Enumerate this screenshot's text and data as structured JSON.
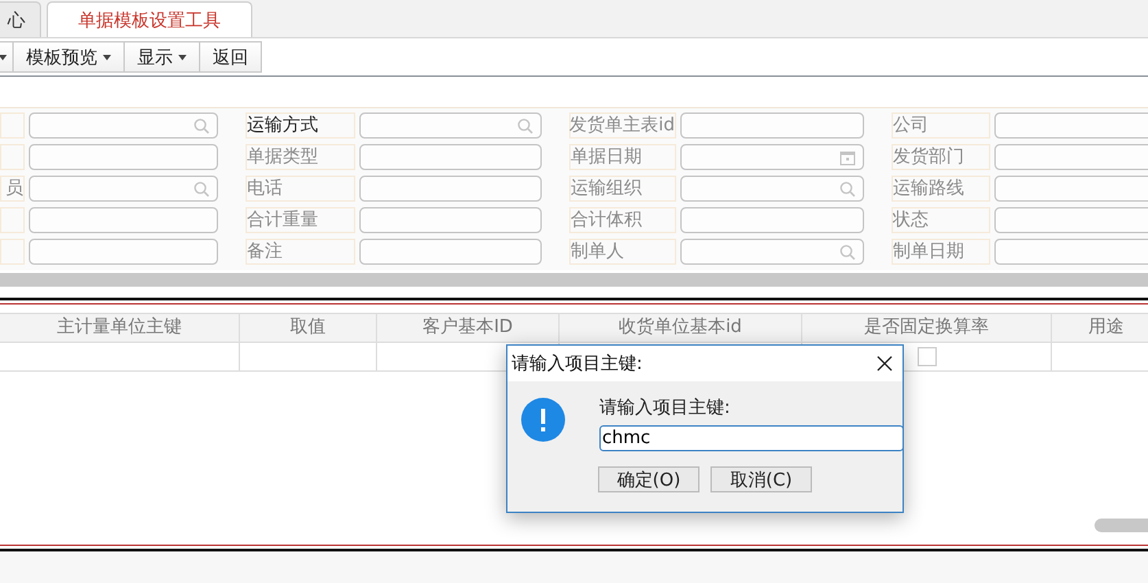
{
  "tabs": [
    {
      "label": "心",
      "selected": false
    },
    {
      "label": "单据模板设置工具",
      "selected": true
    }
  ],
  "toolbar": [
    {
      "menu": true
    },
    {
      "label": "模板预览",
      "menu": true
    },
    {
      "label": "显示",
      "menu": true
    },
    {
      "label": "返回",
      "menu": false
    }
  ],
  "form_rows": [
    [
      {
        "lookup": true
      },
      {
        "label": "运输方式",
        "emphasized": true,
        "lookup": true
      },
      {
        "label": "发货单主表id",
        "emphasized": false
      },
      {
        "label": "公司",
        "emphasized": false
      }
    ],
    [
      {},
      {
        "label": "单据类型",
        "emphasized": false
      },
      {
        "label": "单据日期",
        "emphasized": false,
        "date_picker": true
      },
      {
        "label": "发货部门",
        "emphasized": false
      }
    ],
    [
      {
        "label": "员",
        "emphasized": false,
        "lookup": true
      },
      {
        "label": "电话",
        "emphasized": false
      },
      {
        "label": "运输组织",
        "emphasized": false,
        "lookup": true
      },
      {
        "label": "运输路线",
        "emphasized": false
      }
    ],
    [
      {},
      {
        "label": "合计重量",
        "emphasized": false
      },
      {
        "label": "合计体积",
        "emphasized": false
      },
      {
        "label": "状态",
        "emphasized": false
      }
    ],
    [
      {},
      {
        "label": "备注",
        "emphasized": false
      },
      {
        "label": "制单人",
        "emphasized": false,
        "lookup": true
      },
      {
        "label": "制单日期",
        "emphasized": false
      }
    ]
  ],
  "table": {
    "columns": [
      "主计量单位主键",
      "取值",
      "客户基本ID",
      "收货单位基本id",
      "是否固定换算率",
      "用途"
    ],
    "rows": [
      {
        "checked": false
      }
    ]
  },
  "dialog": {
    "title": "请输入项目主键:",
    "prompt": "请输入项目主键:",
    "value": "chmc",
    "buttons": [
      "确定(O)",
      "取消(C)"
    ]
  }
}
